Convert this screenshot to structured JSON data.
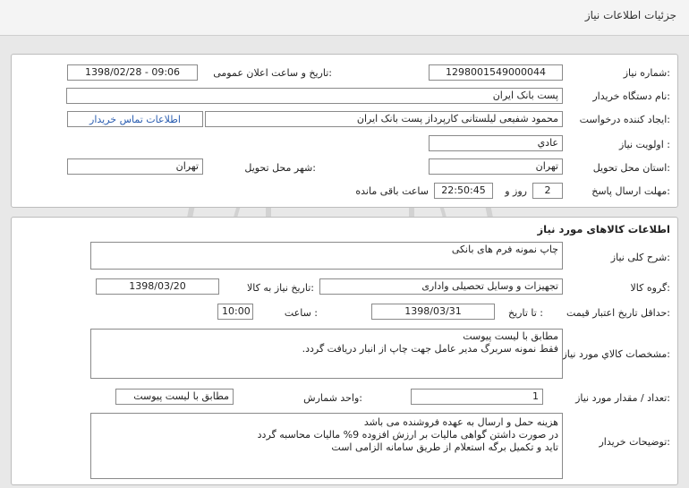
{
  "page": {
    "title": "جزئیات اطلاعات نیاز"
  },
  "info": {
    "need_number_label": "شماره نیاز:",
    "need_number": "1298001549000044",
    "announce_label": "تاریخ و ساعت اعلان عمومی:",
    "announce_value": "1398/02/28 - 09:06",
    "buyer_label": "نام دستگاه خریدار:",
    "buyer_value": "پست بانک ایران",
    "creator_label": "ایجاد کننده درخواست:",
    "creator_value": "محمود شفیعی لیلستانی کارپرداز پست بانک ایران",
    "contact_link": "اطلاعات تماس خریدار",
    "priority_label": "اولویت نیاز :",
    "priority_value": "عادي",
    "province_label": "استان محل تحویل:",
    "province_value": "تهران",
    "city_label": "شهر محل تحویل:",
    "city_value": "تهران",
    "deadline_label": "مهلت ارسال پاسخ:",
    "deadline_days": "2",
    "days_word": "روز و",
    "deadline_time": "22:50:45",
    "remaining_text": "ساعت باقی مانده"
  },
  "goods": {
    "section_title": "اطلاعات کالاهای مورد نیاز",
    "description_label": "شرح کلی نیاز:",
    "description_value": "چاپ نمونه فرم های بانکی",
    "group_label": "گروه کالا:",
    "group_value": "تجهیزات و وسایل تحصیلی واداری",
    "need_date_label": "تاریخ نیاز به کالا:",
    "need_date_value": "1398/03/20",
    "validity_label": "حداقل تاریخ اعتبار قیمت:",
    "until_date_label": "تا تاریخ :",
    "until_date_value": "1398/03/31",
    "time_label": "ساعت :",
    "time_value": "10:00",
    "specs_label": "مشخصات کالاي مورد نیاز:",
    "specs_line1": "مطابق با لیست پیوست",
    "specs_line2": "فقط نمونه سربرگ مدیر عامل  جهت چاپ از انبار دریافت گردد.",
    "quantity_label": "تعداد / مقدار مورد نیاز:",
    "quantity_value": "1",
    "unit_label": "واحد شمارش:",
    "unit_value": "مطابق با لیست پیوست",
    "buyer_notes_label": "توضیحات خریدار:",
    "notes_line1": "هزینه حمل و ارسال به عهده فروشنده می باشد",
    "notes_line2": "در صورت داشتن گواهی مالیات بر ارزش افزوده 9% مالیات محاسبه گردد",
    "notes_line3": "تاید و تکمیل برگه استعلام از طریق سامانه الزامی است"
  }
}
